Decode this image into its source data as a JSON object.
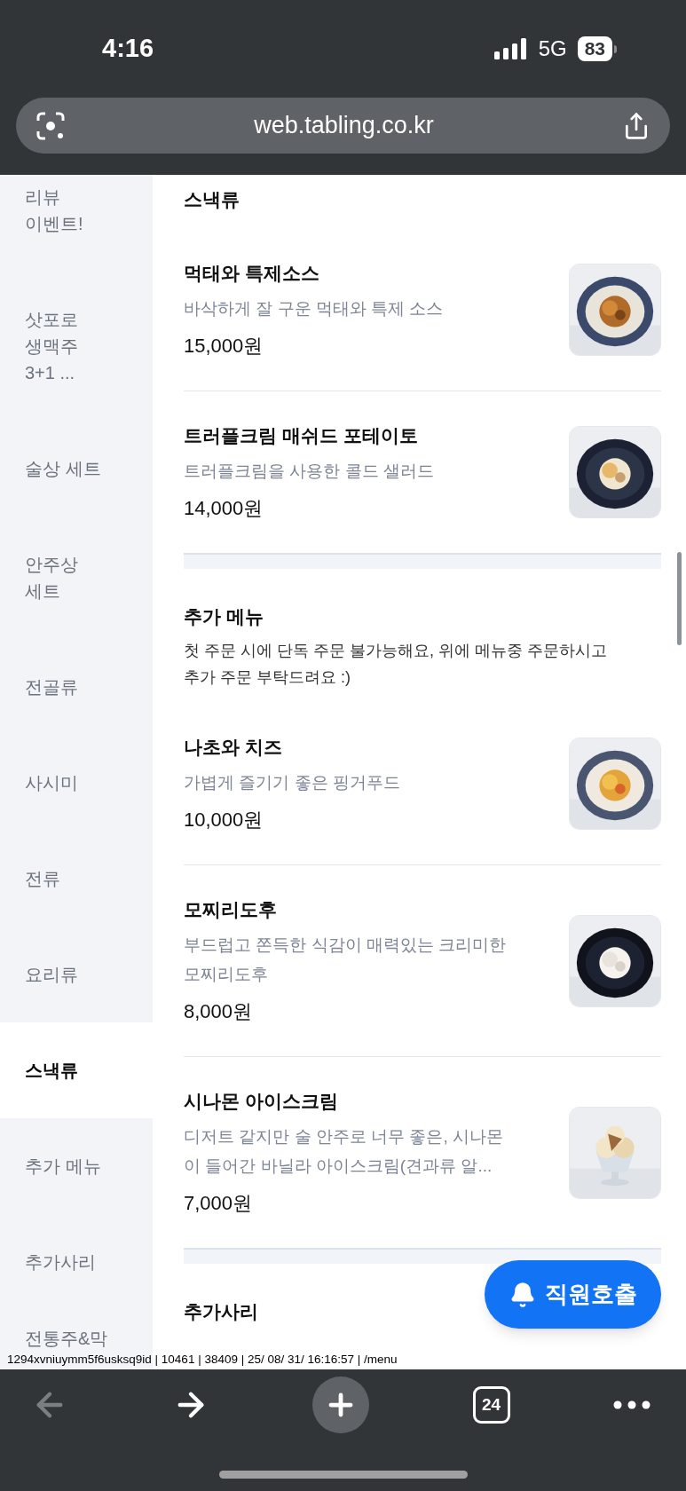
{
  "status_bar": {
    "time": "4:16",
    "network": "5G",
    "battery": "83"
  },
  "browser": {
    "url": "web.tabling.co.kr"
  },
  "sidebar": {
    "items": [
      {
        "lines": [
          "리뷰",
          "이벤트!"
        ],
        "selected": false
      },
      {
        "lines": [
          "삿포로",
          "생맥주",
          "3+1 ..."
        ],
        "selected": false
      },
      {
        "lines": [
          "술상 세트"
        ],
        "selected": false
      },
      {
        "lines": [
          "안주상",
          "세트"
        ],
        "selected": false
      },
      {
        "lines": [
          "전골류"
        ],
        "selected": false
      },
      {
        "lines": [
          "사시미"
        ],
        "selected": false
      },
      {
        "lines": [
          "전류"
        ],
        "selected": false
      },
      {
        "lines": [
          "요리류"
        ],
        "selected": false
      },
      {
        "lines": [
          "스낵류"
        ],
        "selected": true
      },
      {
        "lines": [
          "추가 메뉴"
        ],
        "selected": false
      },
      {
        "lines": [
          "추가사리"
        ],
        "selected": false
      },
      {
        "lines": [
          "전통주&막"
        ],
        "selected": false
      }
    ]
  },
  "sections": [
    {
      "title": "스낵류",
      "items": [
        {
          "name": "먹태와 특제소스",
          "description_lines": [
            "바삭하게 잘 구운 먹태와 특제 소스"
          ],
          "price": "15,000원"
        },
        {
          "name": "트러플크림 매쉬드 포테이토",
          "description_lines": [
            "트러플크림을 사용한 콜드 샐러드"
          ],
          "price": "14,000원"
        }
      ]
    },
    {
      "title": "추가 메뉴",
      "note_lines": [
        "첫 주문 시에 단독 주문 불가능해요, 위에 메뉴중 주문하시고",
        "추가 주문 부탁드려요 :)"
      ],
      "items": [
        {
          "name": "나초와 치즈",
          "description_lines": [
            "가볍게 즐기기 좋은 핑거푸드"
          ],
          "price": "10,000원"
        },
        {
          "name": "모찌리도후",
          "description_lines": [
            "부드럽고 쫀득한 식감이 매력있는 크리미한",
            "모찌리도후"
          ],
          "price": "8,000원"
        },
        {
          "name": "시나몬 아이스크림",
          "description_lines": [
            "디저트 같지만 술 안주로 너무 좋은, 시나몬",
            "이 들어간 바닐라 아이스크림(견과류 알..."
          ],
          "price": "7,000원"
        }
      ]
    },
    {
      "title": "추가사리"
    }
  ],
  "call_button": {
    "label": "직원호출"
  },
  "debug_line": "1294xvniuymm5f6usksq9id | 10461 | 38409 | 25/ 08/ 31/ 16:16:57 | /menu",
  "toolbar": {
    "back_disabled": true,
    "tab_count": "24"
  }
}
